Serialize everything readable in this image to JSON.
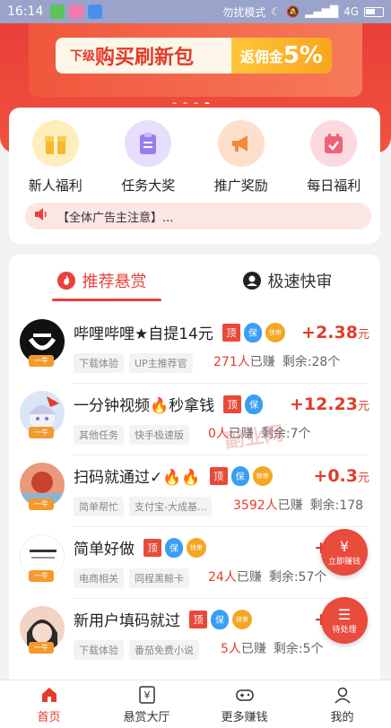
{
  "status_bar": {
    "time": "16:14",
    "mode": "勿扰模式",
    "network": "4G"
  },
  "banner": {
    "small_text": "下级",
    "big_text": "购买刷新包",
    "rebate_text": "返佣金",
    "rebate_pct": "5%"
  },
  "menu": [
    {
      "label": "新人福利",
      "icon": "gift-icon",
      "color": "#f7c544"
    },
    {
      "label": "任务大奖",
      "icon": "clipboard-icon",
      "color": "#9b7cf0"
    },
    {
      "label": "推广奖励",
      "icon": "megaphone-icon",
      "color": "#f28b3c"
    },
    {
      "label": "每日福利",
      "icon": "calendar-icon",
      "color": "#f06279"
    }
  ],
  "notice": {
    "text": "【全体广告主注意】..."
  },
  "tabs": {
    "recommend": "推荐悬赏",
    "fast": "极速快审"
  },
  "badges": {
    "top": "顶",
    "bao": "保",
    "fast": "快审"
  },
  "tasks": [
    {
      "title": "哔哩哔哩★自提14元",
      "price": "+2.38",
      "unit": "元",
      "tags": [
        "下载体验",
        "UP主推荐官"
      ],
      "earned": "271人",
      "earned_suffix": "已赚",
      "remaining": "剩余:28个"
    },
    {
      "title": "一分钟视频🔥秒拿钱",
      "price": "+12.23",
      "unit": "元",
      "tags": [
        "其他任务",
        "快手极速版"
      ],
      "earned": "0人",
      "earned_suffix": "已赚",
      "remaining": "剩余:7个"
    },
    {
      "title": "扫码就通过✓🔥🔥",
      "price": "+0.3",
      "unit": "元",
      "tags": [
        "简单帮忙",
        "支付宝-大成基..."
      ],
      "earned": "3592人",
      "earned_suffix": "已赚",
      "remaining": "剩余:178"
    },
    {
      "title": "简单好做",
      "price": "+",
      "unit": "",
      "tags": [
        "电商相关",
        "同程黑鲸卡"
      ],
      "earned": "24人",
      "earned_suffix": "已赚",
      "remaining": "剩余:57个"
    },
    {
      "title": "新用户填码就过",
      "price": "+",
      "unit": "",
      "tags": [
        "下载体验",
        "番茄免费小说"
      ],
      "earned": "5人",
      "earned_suffix": "已赚",
      "remaining": "剩余:5个"
    }
  ],
  "crown_label": "一牛",
  "float_buttons": {
    "withdraw": "立即赚钱",
    "pending": "待处理",
    "withdraw_icon": "¥",
    "pending_icon": "☰"
  },
  "watermark": "副业网",
  "nav": [
    {
      "label": "首页",
      "icon": "home-icon",
      "active": true
    },
    {
      "label": "悬赏大厅",
      "icon": "yen-icon",
      "active": false
    },
    {
      "label": "更多赚钱",
      "icon": "gamepad-icon",
      "active": false
    },
    {
      "label": "我的",
      "icon": "user-icon",
      "active": false
    }
  ]
}
